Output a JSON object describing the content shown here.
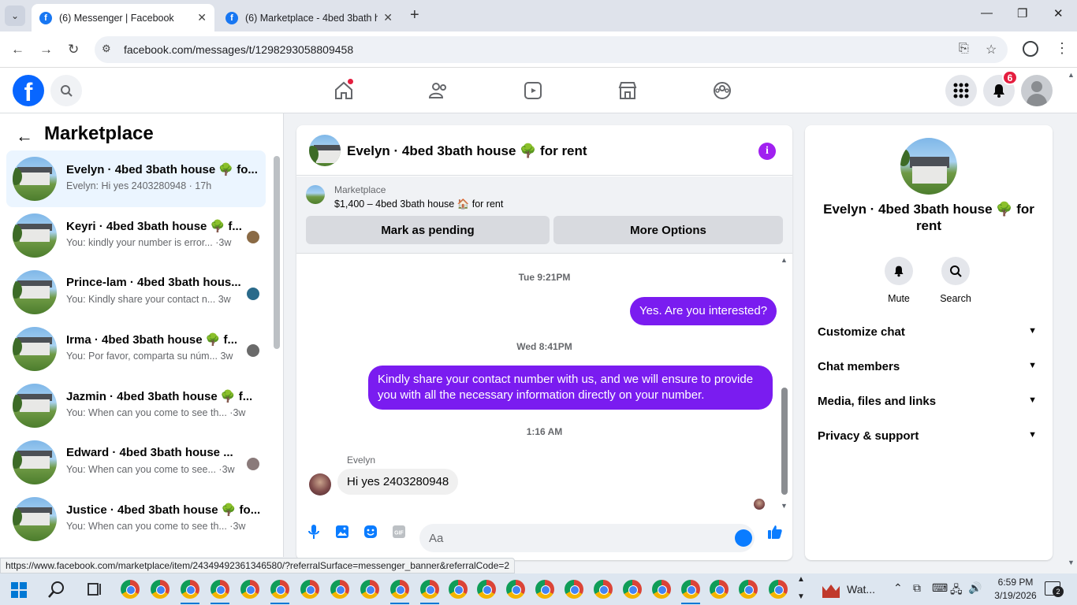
{
  "browser": {
    "tabs": [
      {
        "title": "(6) Messenger | Facebook",
        "active": true
      },
      {
        "title": "(6) Marketplace - 4bed 3bath h",
        "active": false
      }
    ],
    "url": "facebook.com/messages/t/1298293058809458",
    "status_url": "https://www.facebook.com/marketplace/item/24349492361346580/?referralSurface=messenger_banner&referralCode=2"
  },
  "fb_nav": {
    "notifications_count": "6",
    "icons": [
      "home-icon",
      "friends-icon",
      "video-icon",
      "marketplace-icon",
      "groups-icon"
    ]
  },
  "left_panel": {
    "title": "Marketplace",
    "conversations": [
      {
        "name": "Evelyn · 4bed 3bath house 🌳 fo...",
        "snippet": "Evelyn: Hi yes 2403280948 · 17h",
        "active": true
      },
      {
        "name": "Keyri · 4bed 3bath house 🌳 f...",
        "snippet": "You: kindly your number is error... ·3w"
      },
      {
        "name": "Prince-lam · 4bed 3bath hous...",
        "snippet": "You: Kindly share your contact n...  3w"
      },
      {
        "name": "Irma · 4bed 3bath house 🌳 f...",
        "snippet": "You: Por favor, comparta su núm...  3w"
      },
      {
        "name": "Jazmin · 4bed 3bath house 🌳 f...",
        "snippet": "You: When can you come to see th... ·3w"
      },
      {
        "name": "Edward · 4bed 3bath house ...",
        "snippet": "You: When can you come to see... ·3w"
      },
      {
        "name": "Justice · 4bed 3bath house 🌳 fo...",
        "snippet": "You: When can you come to see th... ·3w"
      }
    ]
  },
  "chat": {
    "title": "Evelyn · 4bed 3bath house 🌳 for rent",
    "banner": {
      "label": "Marketplace",
      "listing": "$1,400 – 4bed 3bath house 🏠 for rent",
      "btn_pending": "Mark as pending",
      "btn_more": "More Options"
    },
    "messages": [
      {
        "type": "time",
        "text": "Tue 9:21PM"
      },
      {
        "type": "out",
        "text": "Yes. Are you interested?"
      },
      {
        "type": "time",
        "text": "Wed 8:41PM"
      },
      {
        "type": "out",
        "text": "Kindly share your contact number with us, and we will ensure to provide you with all the necessary information directly on your number."
      },
      {
        "type": "time",
        "text": "1:16 AM"
      },
      {
        "type": "in",
        "sender": "Evelyn",
        "text": "Hi yes 2403280948"
      }
    ],
    "composer_placeholder": "Aa"
  },
  "right_panel": {
    "name": "Evelyn · 4bed 3bath house 🌳 for rent",
    "actions": [
      {
        "label": "Mute"
      },
      {
        "label": "Search"
      }
    ],
    "sections": [
      "Customize chat",
      "Chat members",
      "Media, files and links",
      "Privacy & support"
    ]
  },
  "taskbar": {
    "weather": "Wat...",
    "time": "6:59 PM",
    "date": "3/19/2026",
    "notif_count": "2"
  },
  "colors": {
    "accent": "#7a1cf0",
    "fb_blue": "#0866ff",
    "active_conv": "#ebf5ff"
  }
}
